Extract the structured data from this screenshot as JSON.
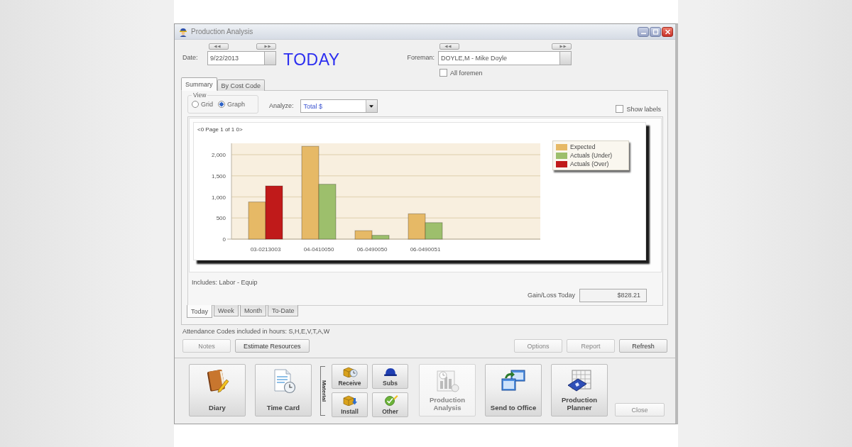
{
  "window": {
    "title": "Production Analysis"
  },
  "header": {
    "date": {
      "label": "Date:",
      "value": "9/22/2013"
    },
    "today_label": "TODAY",
    "foreman": {
      "label": "Foreman:",
      "value": "DOYLE,M - Mike Doyle"
    },
    "all_foremen": {
      "label": "All foremen",
      "checked": false
    }
  },
  "tabs": [
    {
      "label": "Summary",
      "selected": true
    },
    {
      "label": "By Cost Code",
      "selected": false
    }
  ],
  "view": {
    "group_label": "View",
    "options": [
      {
        "label": "Grid",
        "selected": false
      },
      {
        "label": "Graph",
        "selected": true
      }
    ]
  },
  "analyze": {
    "label": "Analyze:",
    "value": "Total $"
  },
  "show_labels": {
    "label": "Show labels",
    "checked": false
  },
  "chart": {
    "pager": "<0 Page 1 of 1 0>",
    "chart_data": {
      "type": "bar",
      "categories": [
        "03-0213003",
        "04-0410050",
        "06-0490050",
        "06-0490051"
      ],
      "series": [
        {
          "name": "Expected",
          "color": "#e6b966",
          "values": [
            880,
            2200,
            200,
            600
          ]
        },
        {
          "name": "Actuals (Under)",
          "color": "#9dbf6c",
          "values": [
            0,
            1300,
            90,
            390
          ]
        },
        {
          "name": "Actuals (Over)",
          "color": "#c01a1a",
          "values": [
            1260,
            0,
            0,
            0
          ]
        }
      ],
      "ylim": [
        0,
        2270
      ],
      "yticks": [
        {
          "value": 0,
          "label": "0"
        },
        {
          "value": 500,
          "label": "500"
        },
        {
          "value": 1000,
          "label": "1,000"
        },
        {
          "value": 1500,
          "label": "1,500"
        },
        {
          "value": 2000,
          "label": "2,000"
        }
      ],
      "grid": true
    }
  },
  "includes": "Includes: Labor - Equip",
  "gain_loss": {
    "label": "Gain/Loss Today",
    "value": "$828.21"
  },
  "period_tabs": [
    {
      "label": "Today",
      "selected": true
    },
    {
      "label": "Week",
      "selected": false
    },
    {
      "label": "Month",
      "selected": false
    },
    {
      "label": "To-Date",
      "selected": false
    }
  ],
  "attendance": "Attendance Codes included in hours: S,H,E,V,T,A,W",
  "left_buttons": [
    {
      "label": "Notes",
      "disabled": true
    },
    {
      "label": "Estimate Resources",
      "disabled": false
    }
  ],
  "right_buttons": [
    {
      "label": "Options",
      "disabled": true
    },
    {
      "label": "Report",
      "disabled": true
    },
    {
      "label": "Refresh",
      "disabled": false
    }
  ],
  "toolbar_left": [
    {
      "label": "Diary",
      "disabled": false
    },
    {
      "label": "Time Card",
      "disabled": false
    }
  ],
  "material": {
    "label": "Material",
    "buttons": [
      {
        "label": "Receive"
      },
      {
        "label": "Subs"
      },
      {
        "label": "Install"
      },
      {
        "label": "Other"
      }
    ]
  },
  "toolbar_right": [
    {
      "label": "Production Analysis",
      "disabled": true
    },
    {
      "label": "Send to Office",
      "disabled": false
    },
    {
      "label": "Production Planner",
      "disabled": false
    }
  ],
  "close_button": {
    "label": "Close",
    "disabled": true
  }
}
